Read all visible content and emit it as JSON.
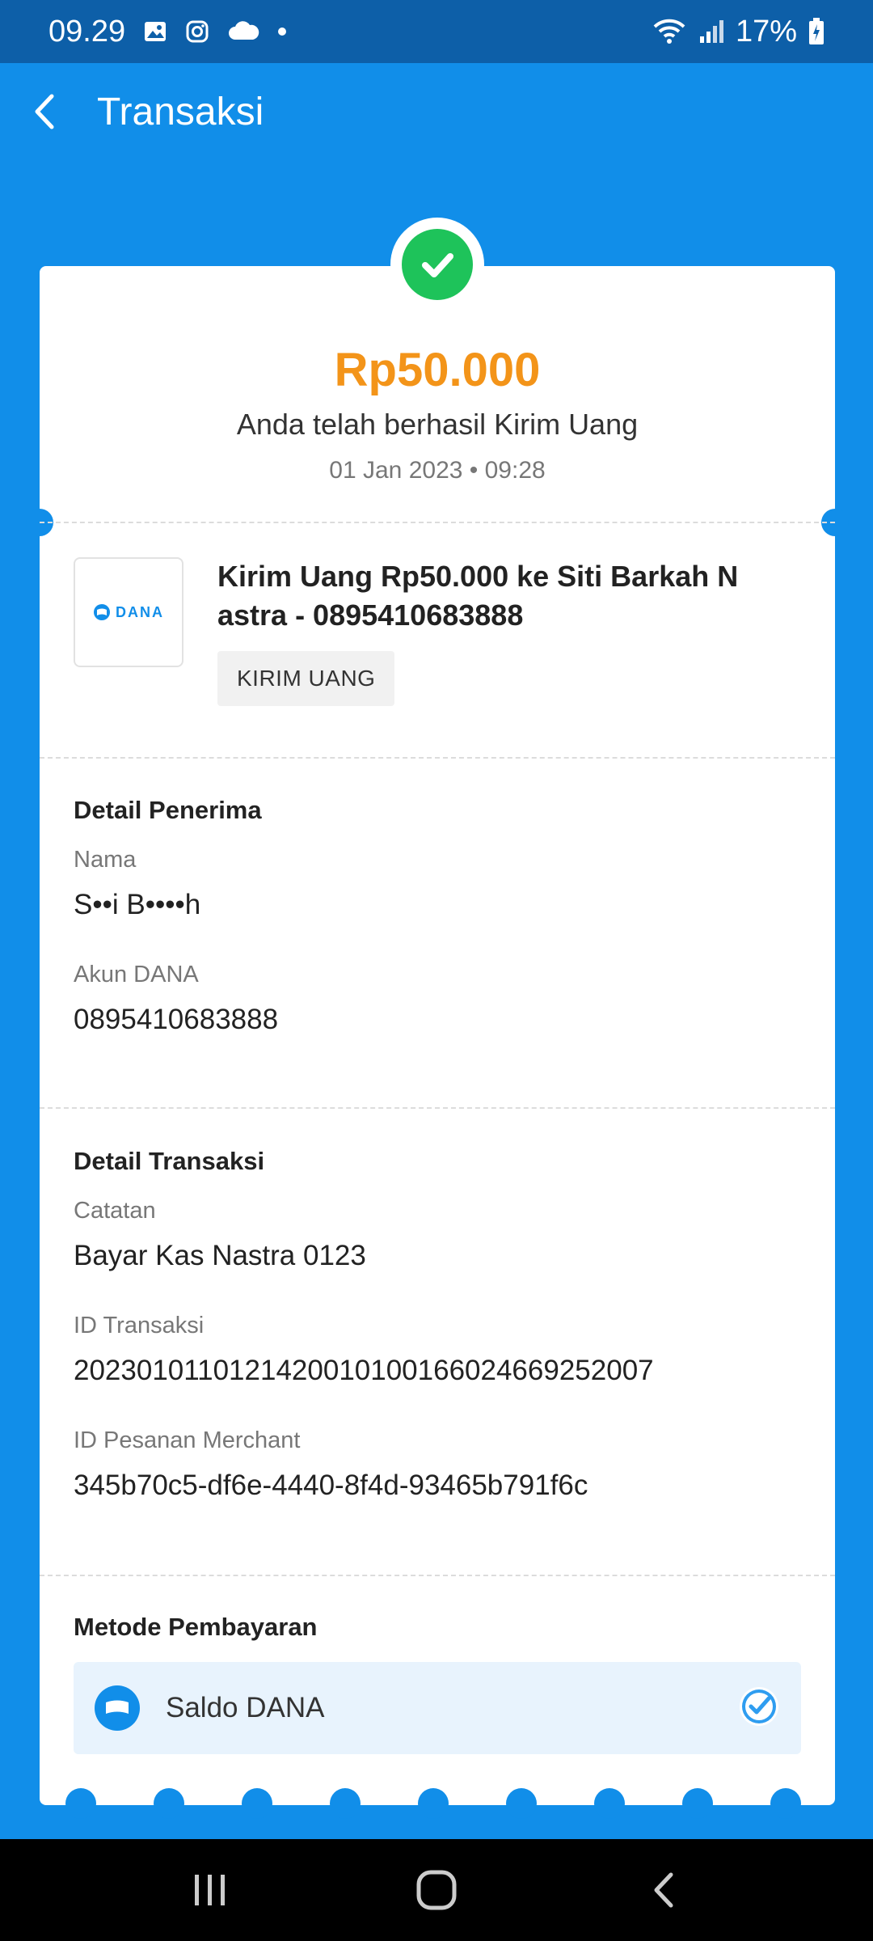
{
  "status_bar": {
    "time": "09.29",
    "battery": "17%"
  },
  "app_bar": {
    "title": "Transaksi"
  },
  "receipt": {
    "amount": "Rp50.000",
    "message": "Anda telah berhasil Kirim Uang",
    "datetime": "01 Jan 2023 • 09:28",
    "transaction_title": "Kirim Uang Rp50.000 ke Siti Barkah N astra - 0895410683888",
    "transaction_tag": "KIRIM UANG",
    "logo_text": "DANA"
  },
  "recipient": {
    "section_title": "Detail Penerima",
    "name_label": "Nama",
    "name_value": "S••i B••••h",
    "account_label": "Akun DANA",
    "account_value": "0895410683888"
  },
  "transaction": {
    "section_title": "Detail Transaksi",
    "note_label": "Catatan",
    "note_value": "Bayar Kas Nastra 0123",
    "id_label": "ID Transaksi",
    "id_value": "2023010110121420010100166024669252007",
    "merchant_label": "ID Pesanan Merchant",
    "merchant_value": "345b70c5-df6e-4440-8f4d-93465b791f6c"
  },
  "payment": {
    "section_title": "Metode Pembayaran",
    "method": "Saldo DANA"
  },
  "colors": {
    "background": "#118ee9",
    "status_bar": "#0d5fa8",
    "amount": "#f39419",
    "success": "#1ec35a"
  }
}
